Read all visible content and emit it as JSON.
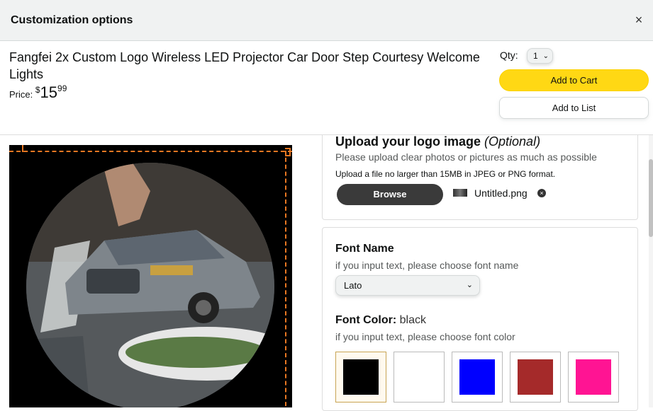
{
  "modal": {
    "title": "Customization options",
    "close_glyph": "×"
  },
  "product": {
    "title": "Fangfei 2x Custom Logo Wireless LED Projector Car Door Step Courtesy Welcome Lights",
    "price_label": "Price:",
    "price_symbol": "$",
    "price_whole": "15",
    "price_fraction": "99",
    "qty_label": "Qty:",
    "qty_value": "1",
    "add_to_cart": "Add to Cart",
    "add_to_list": "Add to List"
  },
  "upload": {
    "title": "Upload your logo image",
    "optional": "(Optional)",
    "hint": "Please upload clear photos or pictures as much as possible",
    "note": "Upload a file no larger than 15MB in JPEG or PNG format.",
    "browse_label": "Browse",
    "file_name": "Untitled.png",
    "remove_glyph": "×"
  },
  "font_name": {
    "title": "Font Name",
    "hint": "if you input text, please choose font name",
    "selected": "Lato"
  },
  "font_color": {
    "title": "Font Color:",
    "value": "black",
    "hint": "if you input text, please choose font color",
    "swatches": [
      {
        "name": "black",
        "hex": "#000000",
        "selected": true
      },
      {
        "name": "white",
        "hex": "#ffffff",
        "selected": false
      },
      {
        "name": "blue",
        "hex": "#0000ff",
        "selected": false
      },
      {
        "name": "red",
        "hex": "#a52a2a",
        "selected": false
      },
      {
        "name": "pink",
        "hex": "#ff1493",
        "selected": false
      }
    ]
  },
  "colors": {
    "accent_yellow": "#ffd814",
    "guide_orange": "#e87722"
  }
}
